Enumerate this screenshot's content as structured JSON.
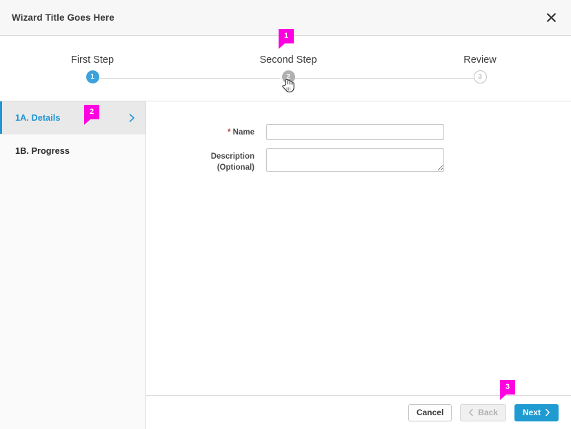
{
  "window": {
    "title": "Wizard Title Goes Here",
    "close_icon": "close-icon"
  },
  "stepper": {
    "steps": [
      {
        "number": "1",
        "label": "First Step",
        "state": "active"
      },
      {
        "number": "2",
        "label": "Second Step",
        "state": "current"
      },
      {
        "number": "3",
        "label": "Review",
        "state": "upcoming"
      }
    ],
    "cursor_icon": "pointer-hand-cursor"
  },
  "sidebar": {
    "items": [
      {
        "label": "1A. Details",
        "selected": true,
        "chevron_icon": "chevron-right-icon"
      },
      {
        "label": "1B. Progress",
        "selected": false
      }
    ]
  },
  "form": {
    "fields": [
      {
        "label": "Name",
        "required_marker": "*",
        "optional_note": "",
        "value": "",
        "placeholder": "",
        "type": "input"
      },
      {
        "label": "Description",
        "required_marker": "",
        "optional_note": "(Optional)",
        "value": "",
        "placeholder": "",
        "type": "textarea"
      }
    ]
  },
  "footer": {
    "cancel_label": "Cancel",
    "back_label": "Back",
    "back_icon": "chevron-left-icon",
    "next_label": "Next",
    "next_icon": "chevron-right-icon"
  },
  "annotations": [
    {
      "number": "1",
      "target": "second-step-label"
    },
    {
      "number": "2",
      "target": "sidebar-item-details"
    },
    {
      "number": "3",
      "target": "back-button"
    }
  ],
  "colors": {
    "accent_blue": "#2196d6",
    "step_active": "#3ba2dc",
    "step_current": "#b0b0b0",
    "next_button": "#1f9bd1",
    "annotation_magenta": "#ff00e0",
    "required_red": "#b23a33"
  }
}
